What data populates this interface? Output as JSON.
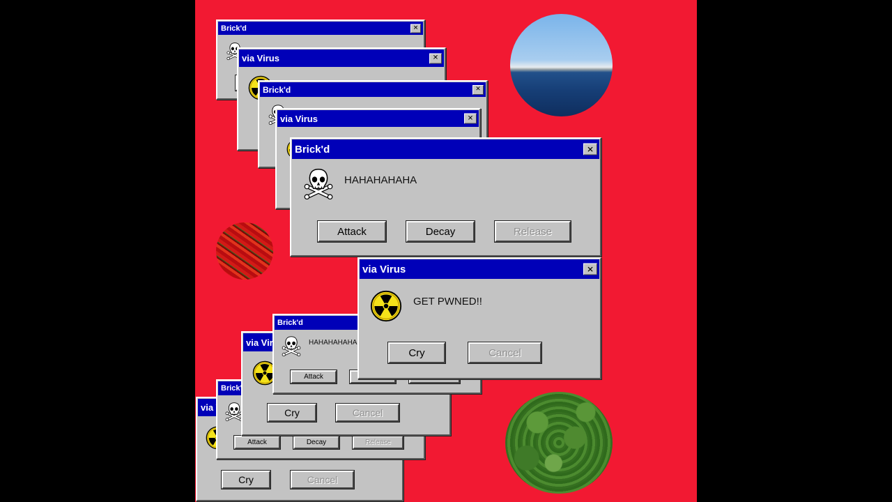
{
  "colors": {
    "background": "#f21932",
    "titlebar": "#0000b8",
    "dialog_face": "#c3c3c3"
  },
  "icons": {
    "skull": "skull-crossbones-icon",
    "radiation": "radiation-icon"
  },
  "dialogs": {
    "d1": {
      "title": "Brick'd"
    },
    "d2": {
      "title": "via Virus"
    },
    "d3": {
      "title": "Brick'd"
    },
    "d4": {
      "title": "via Virus"
    },
    "main_brickd": {
      "title": "Brick'd",
      "message": "HAHAHAHAHA",
      "attack": "Attack",
      "decay": "Decay",
      "release": "Release"
    },
    "main_virus": {
      "title": "via Virus",
      "message": "GET PWNED!!",
      "cry": "Cry",
      "cancel": "Cancel"
    },
    "b1": {
      "title": "Brick'd",
      "message": "HAHAHAHAHA",
      "attack": "Attack"
    },
    "b2": {
      "title": "via Virus",
      "cry": "Cry",
      "cancel": "Cancel"
    },
    "b3": {
      "title": "Brick'd",
      "attack": "Attack",
      "decay": "Decay",
      "release": "Release"
    },
    "b4": {
      "title": "via Virus",
      "cry": "Cry",
      "cancel": "Cancel"
    }
  },
  "photos": [
    "sea-photo",
    "peppers-photo",
    "trees-photo"
  ]
}
